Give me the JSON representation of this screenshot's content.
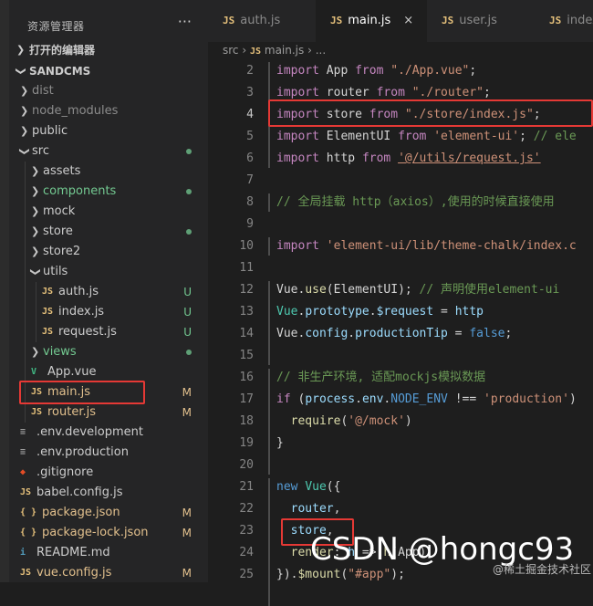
{
  "explorer": {
    "title": "资源管理器",
    "more": "···"
  },
  "sections": {
    "open_editors": "打开的编辑器",
    "project": "SANDCMS"
  },
  "tree": [
    {
      "label": "dist",
      "type": "folder",
      "state": "collapsed",
      "color": "#8c8c8c",
      "level": 1
    },
    {
      "label": "node_modules",
      "type": "folder",
      "state": "collapsed",
      "color": "#8c8c8c",
      "level": 1
    },
    {
      "label": "public",
      "type": "folder",
      "state": "collapsed",
      "color": "#cccccc",
      "level": 1
    },
    {
      "label": "src",
      "type": "folder",
      "state": "expanded",
      "color": "#cccccc",
      "level": 1,
      "status": "dot"
    },
    {
      "label": "assets",
      "type": "folder",
      "state": "collapsed",
      "color": "#cccccc",
      "level": 2
    },
    {
      "label": "components",
      "type": "folder",
      "state": "collapsed",
      "color": "#73c991",
      "level": 2,
      "status": "dot"
    },
    {
      "label": "mock",
      "type": "folder",
      "state": "collapsed",
      "color": "#cccccc",
      "level": 2
    },
    {
      "label": "store",
      "type": "folder",
      "state": "collapsed",
      "color": "#cccccc",
      "level": 2,
      "status": "dot"
    },
    {
      "label": "store2",
      "type": "folder",
      "state": "collapsed",
      "color": "#cccccc",
      "level": 2
    },
    {
      "label": "utils",
      "type": "folder",
      "state": "expanded",
      "color": "#cccccc",
      "level": 2
    },
    {
      "label": "auth.js",
      "type": "js",
      "color": "#cccccc",
      "level": 3,
      "status": "U"
    },
    {
      "label": "index.js",
      "type": "js",
      "color": "#cccccc",
      "level": 3,
      "status": "U"
    },
    {
      "label": "request.js",
      "type": "js",
      "color": "#cccccc",
      "level": 3,
      "status": "U"
    },
    {
      "label": "views",
      "type": "folder",
      "state": "collapsed",
      "color": "#73c991",
      "level": 2,
      "status": "dot"
    },
    {
      "label": "App.vue",
      "type": "vue",
      "color": "#cccccc",
      "level": 2
    },
    {
      "label": "main.js",
      "type": "js",
      "color": "#e2c08d",
      "level": 2,
      "status": "M"
    },
    {
      "label": "router.js",
      "type": "js",
      "color": "#e2c08d",
      "level": 2,
      "status": "M"
    },
    {
      "label": ".env.development",
      "type": "env",
      "color": "#cccccc",
      "level": 1
    },
    {
      "label": ".env.production",
      "type": "env",
      "color": "#cccccc",
      "level": 1
    },
    {
      "label": ".gitignore",
      "type": "git",
      "color": "#cccccc",
      "level": 1
    },
    {
      "label": "babel.config.js",
      "type": "js",
      "color": "#cccccc",
      "level": 1
    },
    {
      "label": "package.json",
      "type": "json",
      "color": "#e2c08d",
      "level": 1,
      "status": "M"
    },
    {
      "label": "package-lock.json",
      "type": "json",
      "color": "#e2c08d",
      "level": 1,
      "status": "M"
    },
    {
      "label": "README.md",
      "type": "md",
      "color": "#cccccc",
      "level": 1
    },
    {
      "label": "vue.config.js",
      "type": "js",
      "color": "#e2c08d",
      "level": 1,
      "status": "M"
    }
  ],
  "tabs": [
    {
      "icon": "JS",
      "label": "auth.js",
      "active": false
    },
    {
      "icon": "JS",
      "label": "main.js",
      "active": true,
      "close": "×"
    },
    {
      "icon": "JS",
      "label": "user.js",
      "active": false
    },
    {
      "icon": "JS",
      "label": "index",
      "active": false
    }
  ],
  "breadcrumb": {
    "folder": "src",
    "sep": "›",
    "icon": "JS",
    "file": "main.js",
    "tail": "› ..."
  },
  "code": [
    {
      "n": "2",
      "t": [
        [
          "kw",
          "import "
        ],
        [
          "pun",
          "App "
        ],
        [
          "kw",
          "from "
        ],
        [
          "str",
          "\"./App.vue\""
        ],
        [
          "pun",
          ";"
        ]
      ]
    },
    {
      "n": "3",
      "t": [
        [
          "kw",
          "import "
        ],
        [
          "pun",
          "router "
        ],
        [
          "kw",
          "from "
        ],
        [
          "str",
          "\"./router\""
        ],
        [
          "pun",
          ";"
        ]
      ]
    },
    {
      "n": "4",
      "t": [
        [
          "kw",
          "import "
        ],
        [
          "pun",
          "store "
        ],
        [
          "kw",
          "from "
        ],
        [
          "str",
          "\"./store/index.js\""
        ],
        [
          "pun",
          ";"
        ]
      ]
    },
    {
      "n": "5",
      "t": [
        [
          "kw",
          "import "
        ],
        [
          "pun",
          "ElementUI "
        ],
        [
          "kw",
          "from "
        ],
        [
          "str",
          "'element-ui'"
        ],
        [
          "pun",
          "; "
        ],
        [
          "cm",
          "// ele"
        ]
      ]
    },
    {
      "n": "6",
      "t": [
        [
          "kw",
          "import "
        ],
        [
          "pun",
          "http "
        ],
        [
          "kw",
          "from "
        ],
        [
          "str",
          "'@/utils/request.js'"
        ]
      ]
    },
    {
      "n": "7",
      "t": []
    },
    {
      "n": "8",
      "t": [
        [
          "cm",
          "// 全局挂载 http（axios）,使用的时候直接使用"
        ]
      ]
    },
    {
      "n": "9",
      "t": []
    },
    {
      "n": "10",
      "t": [
        [
          "kw",
          "import "
        ],
        [
          "str",
          "'element-ui/lib/theme-chalk/index.c"
        ]
      ]
    },
    {
      "n": "11",
      "t": []
    },
    {
      "n": "12",
      "t": [
        [
          "pun",
          "Vue."
        ],
        [
          "fn",
          "use"
        ],
        [
          "pun",
          "(ElementUI); "
        ],
        [
          "cm",
          "// 声明使用element-ui"
        ]
      ]
    },
    {
      "n": "13",
      "t": [
        [
          "cls",
          "Vue"
        ],
        [
          "pun",
          "."
        ],
        [
          "var",
          "prototype"
        ],
        [
          "pun",
          "."
        ],
        [
          "var",
          "$request"
        ],
        [
          "pun",
          " = "
        ],
        [
          "var",
          "http"
        ]
      ]
    },
    {
      "n": "14",
      "t": [
        [
          "pun",
          "Vue."
        ],
        [
          "var",
          "config"
        ],
        [
          "pun",
          "."
        ],
        [
          "var",
          "productionTip"
        ],
        [
          "pun",
          " = "
        ],
        [
          "kb",
          "false"
        ],
        [
          "pun",
          ";"
        ]
      ]
    },
    {
      "n": "15",
      "t": []
    },
    {
      "n": "16",
      "t": [
        [
          "cm",
          "// 非生产环境, 适配mockjs模拟数据"
        ]
      ]
    },
    {
      "n": "17",
      "t": [
        [
          "kw",
          "if "
        ],
        [
          "pun",
          "("
        ],
        [
          "var",
          "process"
        ],
        [
          "pun",
          "."
        ],
        [
          "var",
          "env"
        ],
        [
          "pun",
          "."
        ],
        [
          "kb",
          "NODE_ENV"
        ],
        [
          "pun",
          " !== "
        ],
        [
          "str",
          "'production'"
        ],
        [
          "pun",
          ")"
        ]
      ]
    },
    {
      "n": "18",
      "t": [
        [
          "pun",
          "  "
        ],
        [
          "fn",
          "require"
        ],
        [
          "pun",
          "("
        ],
        [
          "str",
          "'@/mock'"
        ],
        [
          "pun",
          ")"
        ]
      ]
    },
    {
      "n": "19",
      "t": [
        [
          "pun",
          "}"
        ]
      ]
    },
    {
      "n": "20",
      "t": []
    },
    {
      "n": "21",
      "t": [
        [
          "kb",
          "new "
        ],
        [
          "cls",
          "Vue"
        ],
        [
          "pun",
          "({"
        ]
      ]
    },
    {
      "n": "22",
      "t": [
        [
          "pun",
          "  "
        ],
        [
          "var",
          "router"
        ],
        [
          "pun",
          ","
        ]
      ]
    },
    {
      "n": "23",
      "t": [
        [
          "pun",
          "  "
        ],
        [
          "var",
          "store"
        ],
        [
          "pun",
          ","
        ]
      ]
    },
    {
      "n": "24",
      "t": [
        [
          "pun",
          "  "
        ],
        [
          "fn",
          "render"
        ],
        [
          "pun",
          ": "
        ],
        [
          "var",
          "h"
        ],
        [
          "pun",
          " => "
        ],
        [
          "fn",
          "h"
        ],
        [
          "pun",
          "(App)"
        ]
      ]
    },
    {
      "n": "25",
      "t": [
        [
          "pun",
          "})."
        ],
        [
          "fn",
          "$mount"
        ],
        [
          "pun",
          "("
        ],
        [
          "str",
          "\"#app\""
        ],
        [
          "pun",
          ");"
        ]
      ]
    }
  ],
  "watermark": {
    "main": "CSDN @hongc93",
    "sub": "@稀土掘金技术社区"
  }
}
